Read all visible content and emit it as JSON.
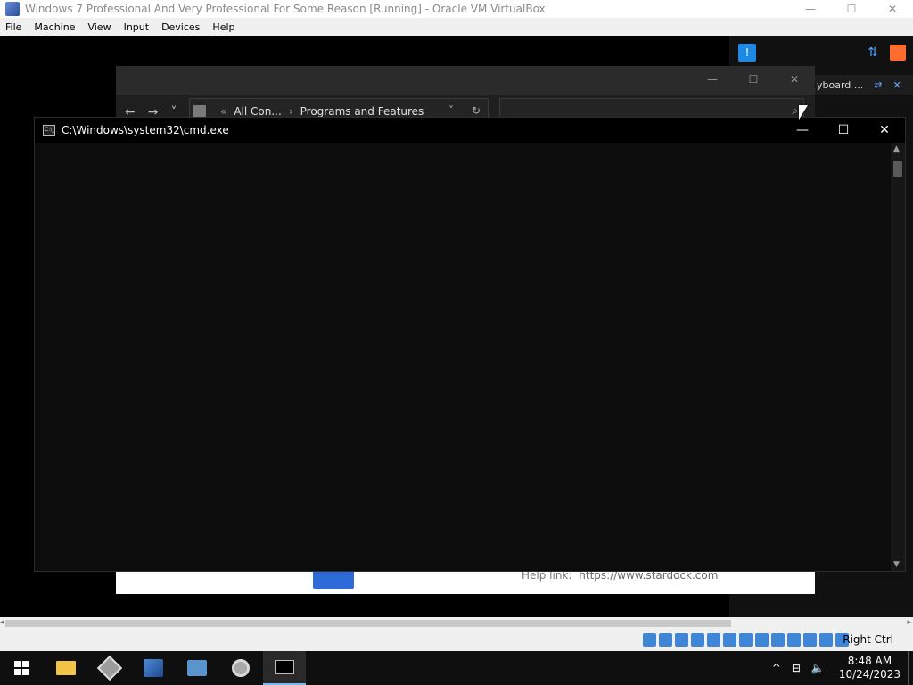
{
  "virtualbox": {
    "window_title": "Windows 7 Professional And Very Professional For Some Reason [Running] - Oracle VM VirtualBox",
    "menu": [
      "File",
      "Machine",
      "View",
      "Input",
      "Devices",
      "Help"
    ],
    "host_key": "Right Ctrl"
  },
  "side_panel": {
    "keyboard_label": "yboard ..."
  },
  "control_panel": {
    "breadcrumb": [
      "All Con...",
      "Programs and Features"
    ],
    "help_label": "Help link:",
    "help_link": "https://www.stardock.com"
  },
  "cmd": {
    "title": "C:\\Windows\\system32\\cmd.exe",
    "icon_text": "C:\\_"
  },
  "taskbar": {
    "time": "8:48 AM",
    "date": "10/24/2023",
    "apps": [
      "file-explorer",
      "virtualbox",
      "windows-7-vm",
      "remote-desktop",
      "disc-burner",
      "command-prompt"
    ]
  },
  "colors": {
    "cmd_background": "#0c0c0c",
    "taskbar_background": "#0f0f0f",
    "accent": "#76b9ed",
    "notification_blue": "#1e88e5",
    "folder_yellow": "#f3c546"
  }
}
